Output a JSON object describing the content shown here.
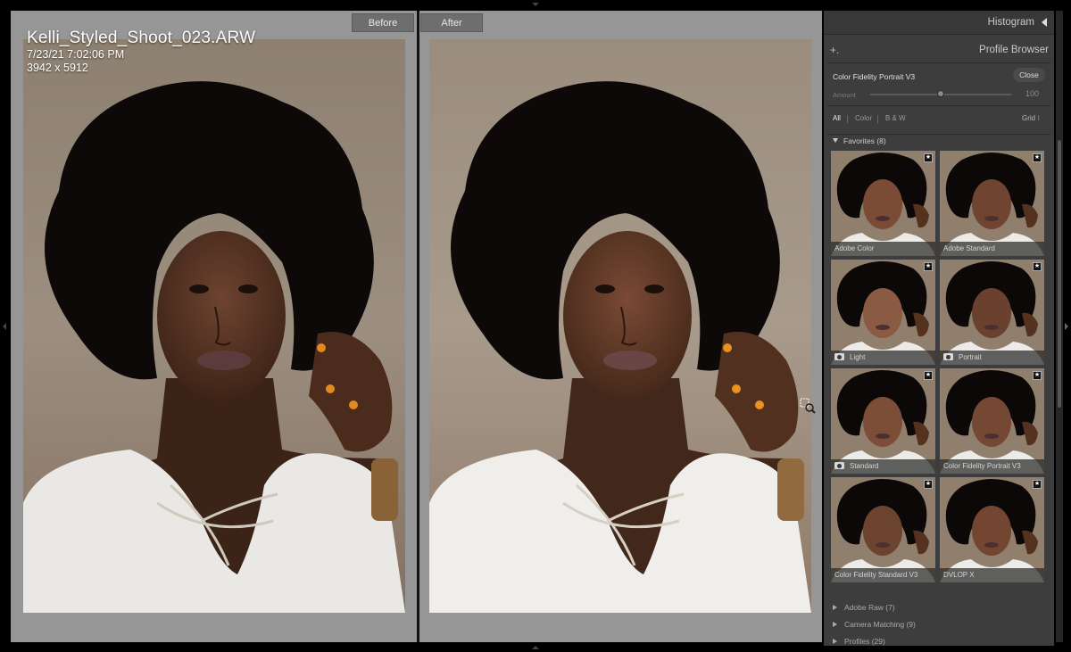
{
  "viewer": {
    "before_tab": "Before",
    "after_tab": "After",
    "info": {
      "filename": "Kelli_Styled_Shoot_023.ARW",
      "datetime": "7/23/21 7:02:06 PM",
      "dimensions": "3942 x 5912"
    }
  },
  "panel": {
    "histogram_label": "Histogram",
    "profile_browser_label": "Profile Browser",
    "add_icon": "+.",
    "current_profile": "Color Fidelity Portrait V3",
    "close_label": "Close",
    "amount_label": "Amount",
    "amount_value": "100",
    "amount_fraction": 0.5,
    "filters": [
      "All",
      "Color",
      "B & W"
    ],
    "view_mode": "Grid ⁝",
    "favorites_header": "Favorites (8)",
    "favorites": [
      {
        "label": "Adobe Color",
        "camera": false,
        "selected": false
      },
      {
        "label": "Adobe Standard",
        "camera": false,
        "selected": false
      },
      {
        "label": "Light",
        "camera": true,
        "selected": false
      },
      {
        "label": "Portrait",
        "camera": true,
        "selected": false
      },
      {
        "label": "Standard",
        "camera": true,
        "selected": false
      },
      {
        "label": "Color Fidelity Portrait V3",
        "camera": false,
        "selected": true
      },
      {
        "label": "Color Fidelity Standard V3",
        "camera": false,
        "selected": false
      },
      {
        "label": "DVLOP X",
        "camera": false,
        "selected": false
      }
    ],
    "groups": [
      "Adobe Raw (7)",
      "Camera Matching (9)",
      "Profiles (29)"
    ]
  },
  "colors": {
    "viewer_bg": "#969696",
    "panel_bg": "#3d3d3d",
    "selected_outline": "#e6e6e6"
  }
}
